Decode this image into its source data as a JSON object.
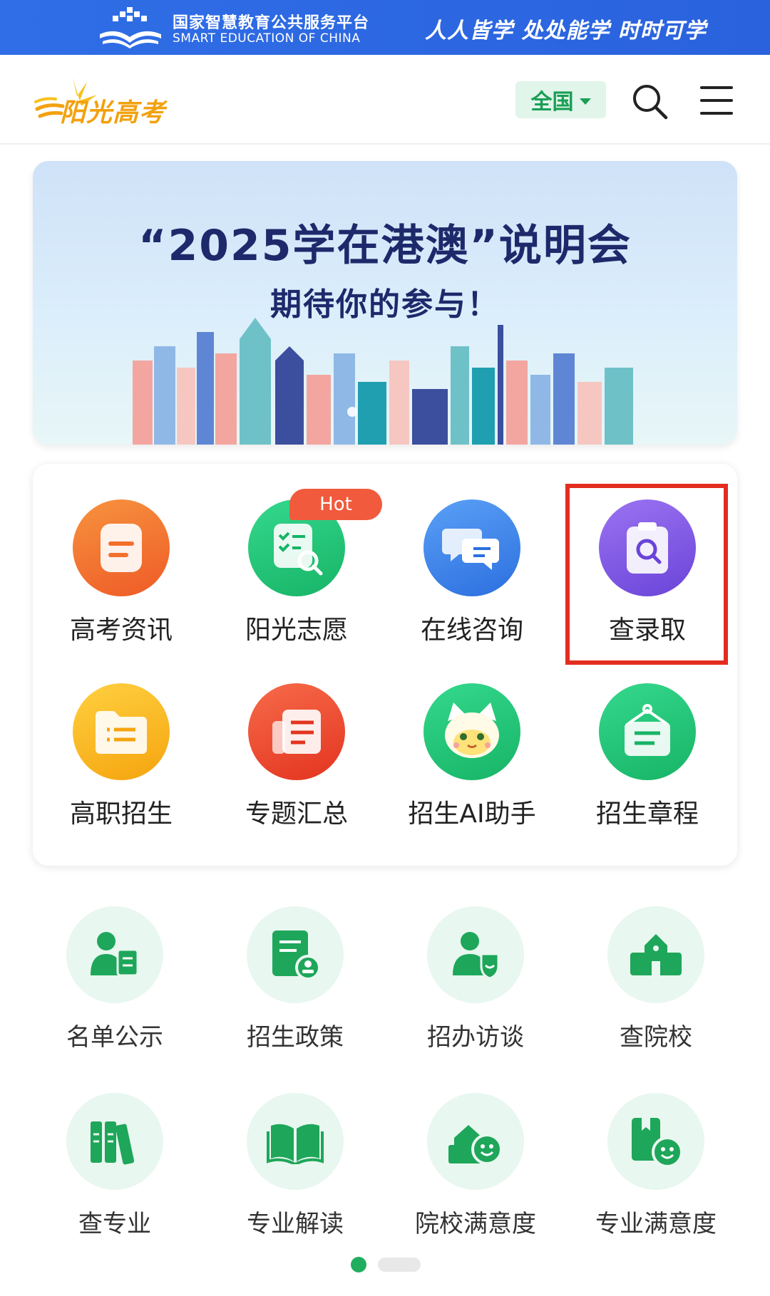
{
  "platform_bar": {
    "name_cn": "国家智慧教育公共服务平台",
    "name_en": "SMART EDUCATION OF CHINA",
    "slogan": "人人皆学 处处能学 时时可学",
    "color": "#2f6ee6"
  },
  "header": {
    "brand": "阳光高考",
    "region_label": "全国",
    "icons": [
      "sun-logo-icon",
      "search-icon",
      "menu-icon"
    ]
  },
  "banner": {
    "title": "“2025学在港澳”说明会",
    "subtitle": "期待你的参与！"
  },
  "features": [
    {
      "label": "高考资讯",
      "icon": "document-icon",
      "color": "#f3722c"
    },
    {
      "label": "阳光志愿",
      "icon": "checklist-search-icon",
      "color": "#20c47a",
      "badge": "Hot"
    },
    {
      "label": "在线咨询",
      "icon": "chat-bubbles-icon",
      "color": "#3f86ee"
    },
    {
      "label": "查录取",
      "icon": "clipboard-search-icon",
      "color": "#7f5ae6"
    },
    {
      "label": "高职招生",
      "icon": "folder-list-icon",
      "color": "#f7b21b"
    },
    {
      "label": "专题汇总",
      "icon": "newspaper-icon",
      "color": "#ee4830"
    },
    {
      "label": "招生AI助手",
      "icon": "mascot-icon",
      "color": "#20c47a"
    },
    {
      "label": "招生章程",
      "icon": "hanging-sign-icon",
      "color": "#20c47a"
    }
  ],
  "services": [
    {
      "label": "名单公示",
      "icon": "person-document-icon"
    },
    {
      "label": "招生政策",
      "icon": "policy-document-icon"
    },
    {
      "label": "招办访谈",
      "icon": "person-shield-icon"
    },
    {
      "label": "查院校",
      "icon": "school-building-icon"
    },
    {
      "label": "查专业",
      "icon": "books-icon"
    },
    {
      "label": "专业解读",
      "icon": "open-book-icon"
    },
    {
      "label": "院校满意度",
      "icon": "school-smile-icon"
    },
    {
      "label": "专业满意度",
      "icon": "book-smile-icon"
    }
  ],
  "pager": {
    "pages": 2,
    "current": 1
  },
  "accent_color": "#1fae5e",
  "highlight_color": "#e32d1f"
}
